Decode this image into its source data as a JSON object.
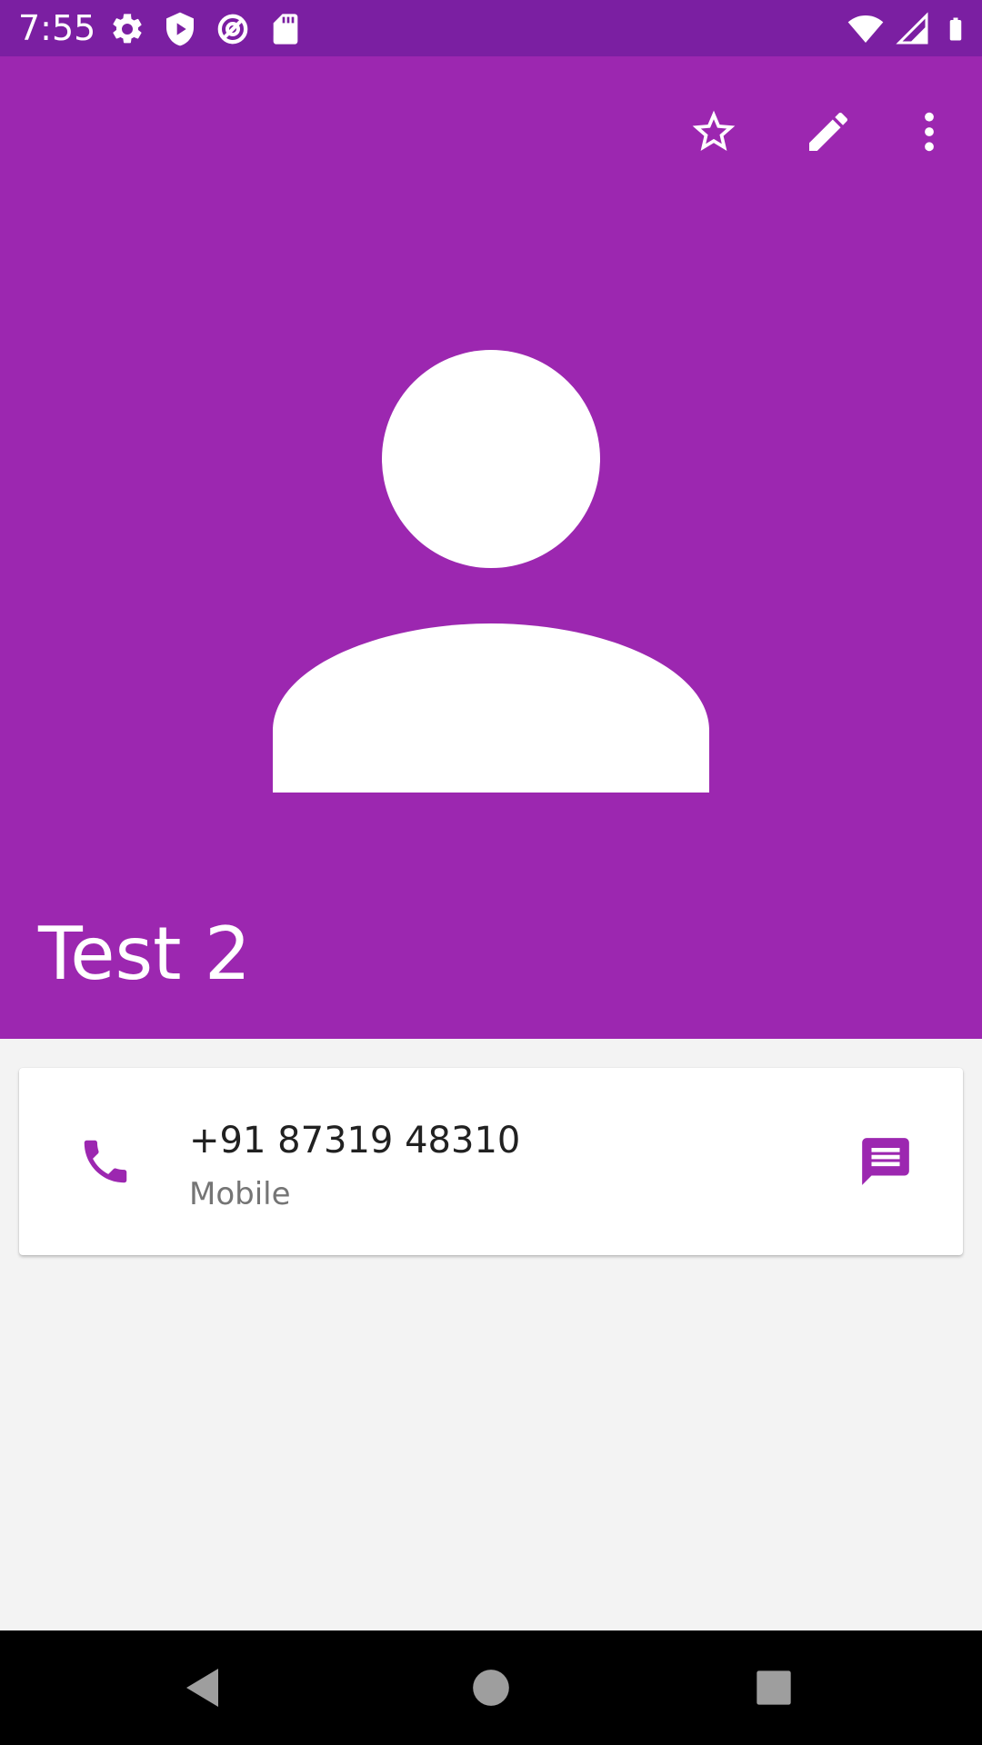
{
  "status_bar": {
    "time": "7:55",
    "left_icons": [
      "settings-icon",
      "play-protect-icon",
      "vpn-icon",
      "sd-card-icon"
    ],
    "right_icons": [
      "wifi-icon",
      "signal-icon",
      "battery-icon"
    ],
    "background": "#7b1fa2"
  },
  "header": {
    "background": "#9c27b0",
    "actions": [
      "star-outline-icon",
      "edit-pencil-icon",
      "more-vert-icon"
    ],
    "avatar": "default-person-icon",
    "contact_name": "Test 2"
  },
  "phone_card": {
    "number": "+91 87319 48310",
    "type": "Mobile",
    "call_icon": "phone-icon",
    "message_icon": "message-icon",
    "accent": "#9c27b0"
  },
  "nav_bar": {
    "buttons": [
      "back-icon",
      "home-icon",
      "recents-icon"
    ]
  }
}
